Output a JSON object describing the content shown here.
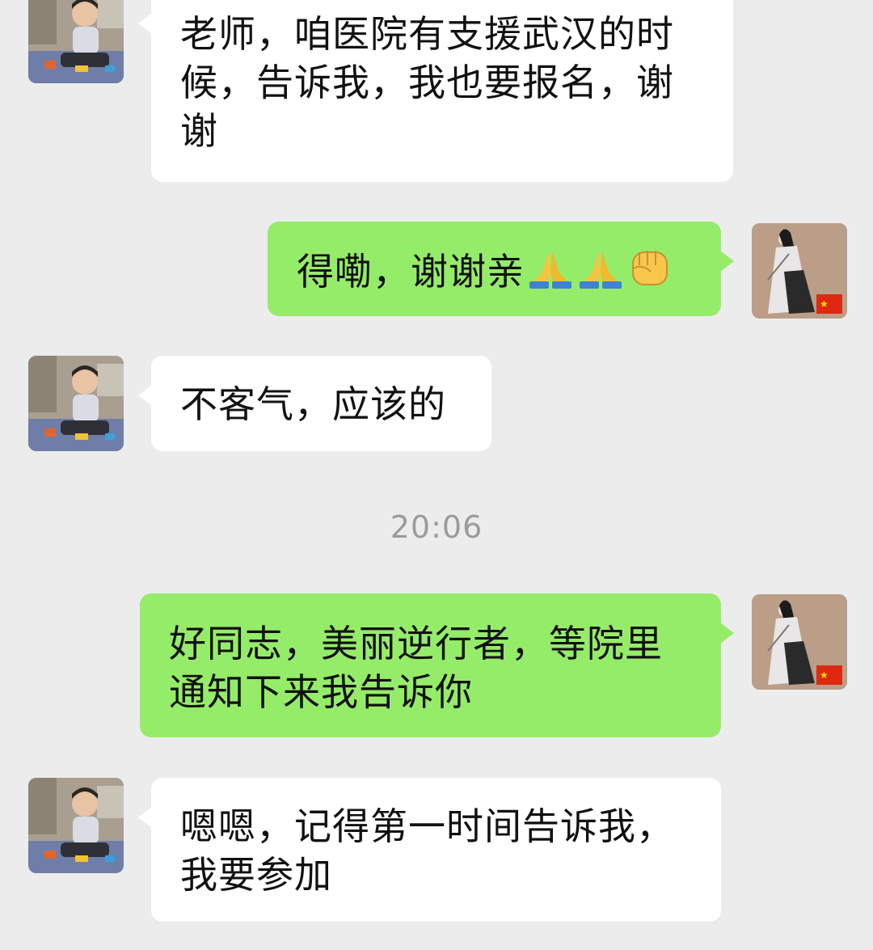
{
  "messages": [
    {
      "side": "in",
      "text": "老师，咱医院有支援武汉的时候，告诉我，我也要报名，谢谢"
    },
    {
      "side": "out",
      "text": "得嘞，谢谢亲",
      "emojis": [
        "folded-hands-icon",
        "folded-hands-icon",
        "raised-fist-icon"
      ]
    },
    {
      "side": "in",
      "text": "不客气，应该的"
    },
    {
      "side": "out",
      "text": "好同志，美丽逆行者，等院里通知下来我告诉你"
    },
    {
      "side": "in",
      "text": "嗯嗯，记得第一时间告诉我，我要参加"
    }
  ],
  "timestamp": "20:06",
  "colors": {
    "background": "#ececec",
    "incoming_bubble": "#ffffff",
    "outgoing_bubble": "#95ec69",
    "timestamp": "#9b9b9b"
  }
}
